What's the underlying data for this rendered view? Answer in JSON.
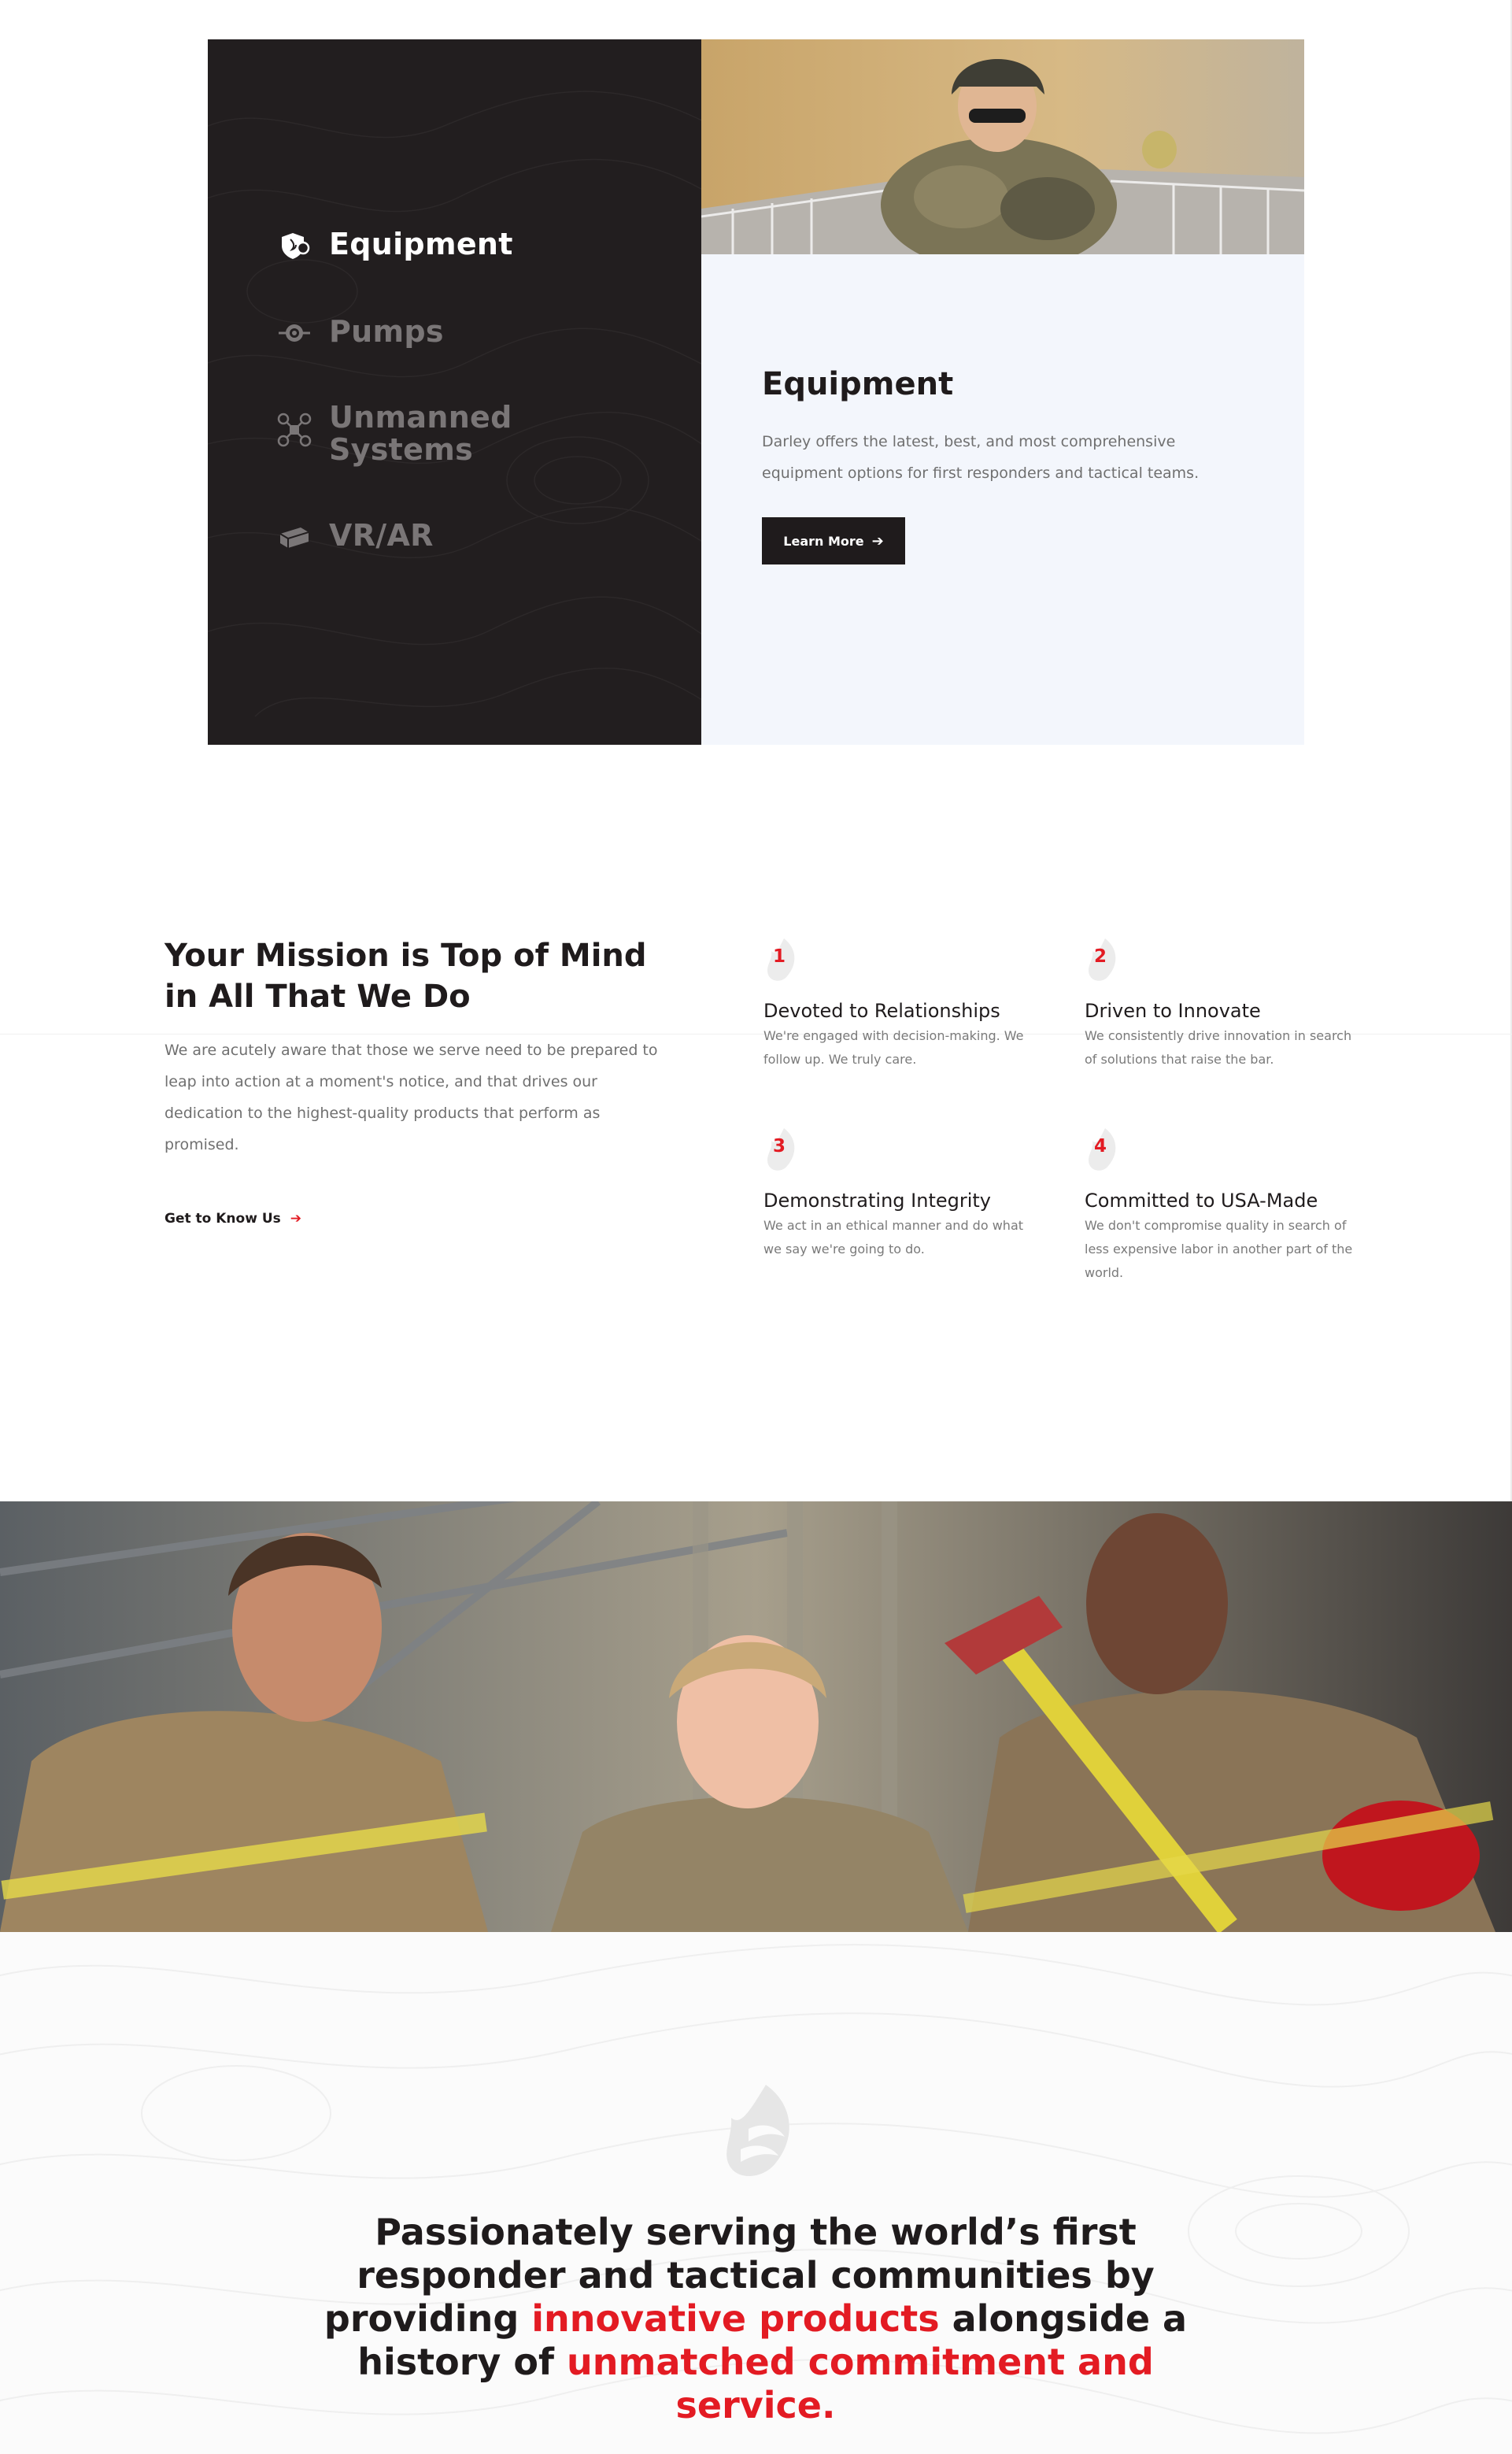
{
  "categories": {
    "items": [
      {
        "label": "Equipment",
        "icon": "shield-fire-icon",
        "active": true
      },
      {
        "label": "Pumps",
        "icon": "pump-icon",
        "active": false
      },
      {
        "label": "Unmanned Systems",
        "icon": "drone-icon",
        "active": false
      },
      {
        "label": "VR/AR",
        "icon": "vr-headset-icon",
        "active": false
      }
    ],
    "detail": {
      "title": "Equipment",
      "description": "Darley offers the latest, best, and most comprehensive equipment options for first responders and tactical teams.",
      "button_label": "Learn More"
    }
  },
  "mission": {
    "title": "Your Mission is Top of Mind in All That We Do",
    "body": "We are acutely aware that those we serve need to be prepared to leap into action at a moment's notice, and that drives our dedication to the highest-quality products that perform as promised.",
    "link_label": "Get to Know Us",
    "values": [
      {
        "number": "1",
        "title": "Devoted to Relationships",
        "description": "We're engaged with decision-making. We follow up. We truly care."
      },
      {
        "number": "2",
        "title": "Driven to Innovate",
        "description": "We consistently drive innovation in search of solutions that raise the bar."
      },
      {
        "number": "3",
        "title": "Demonstrating Integrity",
        "description": "We act in an ethical manner and do what we say we're going to do."
      },
      {
        "number": "4",
        "title": "Committed to USA-Made",
        "description": "We don't compromise quality in search of less expensive labor in another part of the world."
      }
    ]
  },
  "statement": {
    "part1": "Passionately serving the world’s first responder and tactical communities by providing ",
    "highlight1": "innovative products",
    "part2": " alongside a history of ",
    "highlight2": "unmatched commitment and service."
  },
  "colors": {
    "accent": "#e31b23",
    "dark": "#221e1f",
    "panel_light": "#f3f6fc"
  }
}
